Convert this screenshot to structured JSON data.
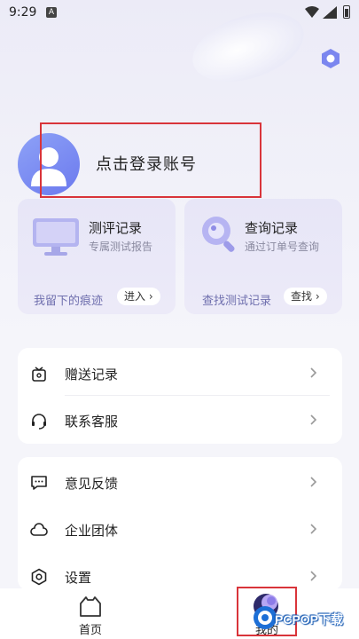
{
  "status_bar": {
    "time": "9:29",
    "notification_icon": "A"
  },
  "header": {
    "settings_icon": "hexagon-settings-icon"
  },
  "profile": {
    "login_text": "点击登录账号",
    "avatar_icon": "user-avatar-icon"
  },
  "cards": [
    {
      "title": "测评记录",
      "subtitle": "专属测试报告",
      "footer": "我留下的痕迹",
      "button": "进入",
      "icon": "monitor-icon"
    },
    {
      "title": "查询记录",
      "subtitle": "通过订单号查询",
      "footer": "查找测试记录",
      "button": "查找",
      "icon": "magnifier-icon"
    }
  ],
  "menu_group1": [
    {
      "label": "赠送记录",
      "icon": "gift-icon"
    },
    {
      "label": "联系客服",
      "icon": "headset-icon"
    }
  ],
  "menu_group2": [
    {
      "label": "意见反馈",
      "icon": "feedback-icon"
    },
    {
      "label": "企业团体",
      "icon": "cloud-icon"
    },
    {
      "label": "设置",
      "icon": "settings-icon"
    }
  ],
  "tabs": [
    {
      "label": "首页",
      "icon": "home-icon",
      "active": false
    },
    {
      "label": "我的",
      "icon": "mine-icon",
      "active": true
    }
  ],
  "watermark": {
    "text": "PCPOP下载"
  },
  "colors": {
    "accent": "#7b86ef",
    "highlight_box": "#d9343a",
    "card_bg": "#e9e8f8"
  }
}
